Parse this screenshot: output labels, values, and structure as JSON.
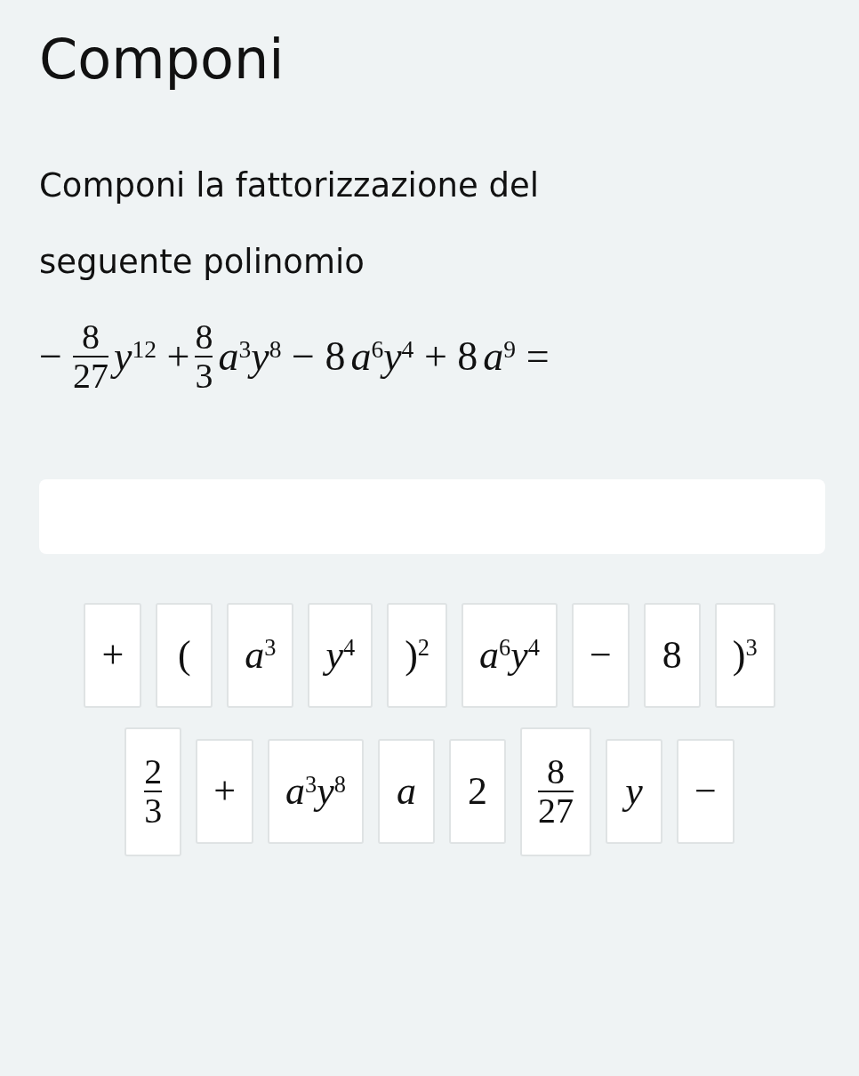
{
  "title": "Componi",
  "prompt": "Componi la fattorizzazione del seguente polinomio",
  "expression": [
    {
      "kind": "frac",
      "sign": "−",
      "num": "8",
      "den": "27"
    },
    {
      "kind": "text",
      "text": "*y*$^{12}$ + "
    },
    {
      "kind": "frac",
      "num": "8",
      "den": "3"
    },
    {
      "kind": "text",
      "text": "*a*$^{3}$*y*$^{8}$ − 8"
    },
    {
      "kind": "text",
      "text": "*a*$^{6}$*y*$^{4}$ + 8"
    },
    {
      "kind": "text",
      "text": "*a*$^{9}$ ="
    }
  ],
  "tiles": [
    {
      "kind": "text",
      "text": "+"
    },
    {
      "kind": "text",
      "text": "("
    },
    {
      "kind": "text",
      "text": "*a*$^{3}$"
    },
    {
      "kind": "text",
      "text": "*y*$^{4}$"
    },
    {
      "kind": "text",
      "text": ")$^{2}$"
    },
    {
      "kind": "text",
      "text": "*a*$^{6}$*y*$^{4}$"
    },
    {
      "kind": "text",
      "text": "−"
    },
    {
      "kind": "text",
      "text": "8"
    },
    {
      "kind": "text",
      "text": ")$^{3}$"
    },
    {
      "kind": "frac",
      "num": "2",
      "den": "3"
    },
    {
      "kind": "text",
      "text": "+"
    },
    {
      "kind": "text",
      "text": "*a*$^{3}$*y*$^{8}$"
    },
    {
      "kind": "text",
      "text": "*a*"
    },
    {
      "kind": "text",
      "text": "2"
    },
    {
      "kind": "frac",
      "num": "8",
      "den": "27"
    },
    {
      "kind": "text",
      "text": "*y*"
    },
    {
      "kind": "text",
      "text": "−"
    }
  ]
}
